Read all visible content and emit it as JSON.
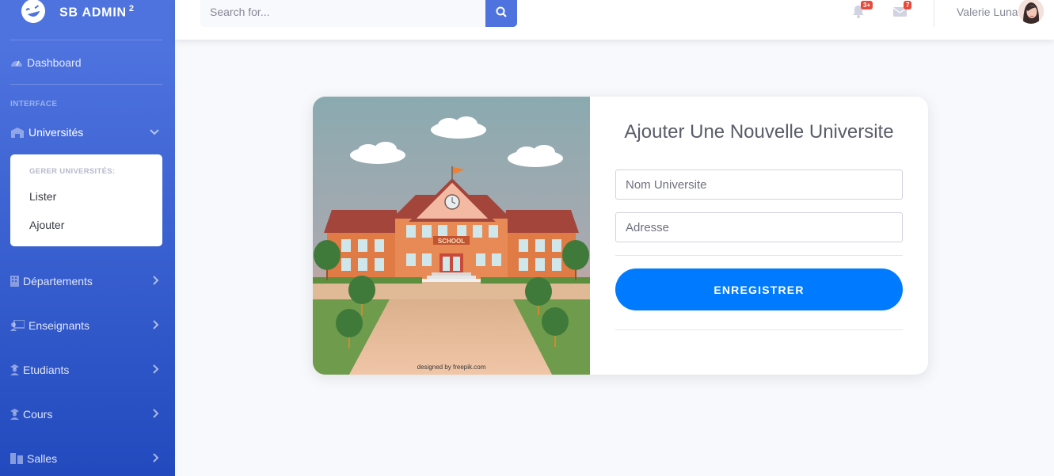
{
  "brand": {
    "name": "SB ADMIN",
    "sup": "2"
  },
  "sidebar": {
    "dashboard": "Dashboard",
    "heading_interface": "INTERFACE",
    "universites": "Universités",
    "collapse": {
      "header": "GERER UNIVERSITÉS:",
      "items": [
        "Lister",
        "Ajouter"
      ]
    },
    "items": [
      "Départements",
      "Enseignants",
      "Etudiants",
      "Cours",
      "Salles"
    ]
  },
  "topbar": {
    "search_placeholder": "Search for...",
    "alerts_badge": "3+",
    "messages_badge": "7",
    "user_name": "Valerie Luna"
  },
  "form": {
    "title": "Ajouter Une Nouvelle Universite",
    "name_placeholder": "Nom Universite",
    "address_placeholder": "Adresse",
    "submit_label": "ENREGISTRER"
  },
  "illustration": {
    "sign": "SCHOOL",
    "credit": "designed by freepik.com"
  },
  "colors": {
    "primary": "#4e73df",
    "button": "#007bff",
    "badge": "#e74a3b"
  }
}
